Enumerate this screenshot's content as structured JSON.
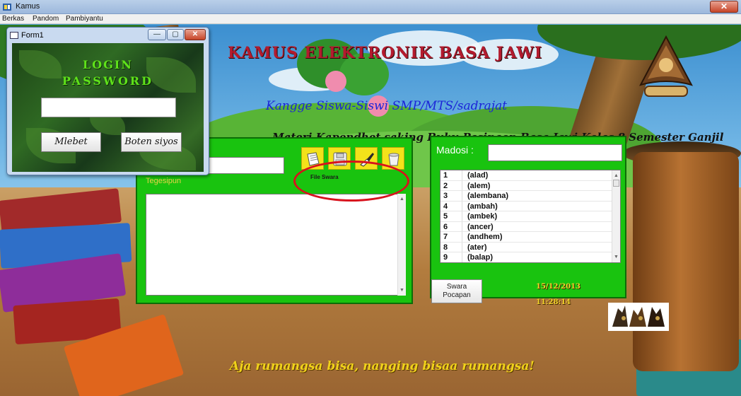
{
  "window": {
    "title": "Kamus",
    "close_glyph": "✕"
  },
  "menu": [
    "Berkas",
    "Pandom",
    "Pambiyantu"
  ],
  "banner": {
    "title": "KAMUS ELEKTRONIK BASA JAWI",
    "subtitle": "Kangge Siswa-Siswi SMP/MTS/sadrajat",
    "materi": "Materi Kapendhet saking Buku Pasinaon Basa Jawi Kelas 8 Semester Ganjil",
    "motto": "Aja rumangsa bisa, nanging bisaa rumangsa!"
  },
  "translate_panel": {
    "word_value": "",
    "tegesipun_label": "Tegesipun",
    "meaning_value": "",
    "file_swara_label": "File Swara",
    "toolbar_icons": [
      "new-file-icon",
      "save-icon",
      "brush-icon",
      "clear-icon"
    ]
  },
  "search_panel": {
    "madosi_label": "Madosi :",
    "search_value": "",
    "words": [
      {
        "no": "1",
        "word": "(alad)"
      },
      {
        "no": "2",
        "word": "(alem)"
      },
      {
        "no": "3",
        "word": "(alembana)"
      },
      {
        "no": "4",
        "word": "(ambah)"
      },
      {
        "no": "5",
        "word": "(ambek)"
      },
      {
        "no": "6",
        "word": "(ancer)"
      },
      {
        "no": "7",
        "word": "(andhem)"
      },
      {
        "no": "8",
        "word": "(ater)"
      },
      {
        "no": "9",
        "word": "(balap)"
      }
    ]
  },
  "swara_button": {
    "line1": "Swara",
    "line2": "Pocapan"
  },
  "clock": {
    "date": "15/12/2013",
    "time": "11:28:14"
  },
  "form1": {
    "title": "Form1",
    "login_label": "LOGIN",
    "password_label": "PASSWORD",
    "password_value": "",
    "ok_button": "Mlebet",
    "cancel_button": "Boten siyos",
    "minimize_glyph": "—",
    "maximize_glyph": "▢",
    "close_glyph": "✕"
  },
  "colors": {
    "panel_green": "#19c30f",
    "title_red": "#b31b2e",
    "subtitle_blue": "#1b24d8",
    "accent_yellow": "#f0d21a",
    "highlight_ring": "#d8121d",
    "login_green": "#5fe21a"
  }
}
